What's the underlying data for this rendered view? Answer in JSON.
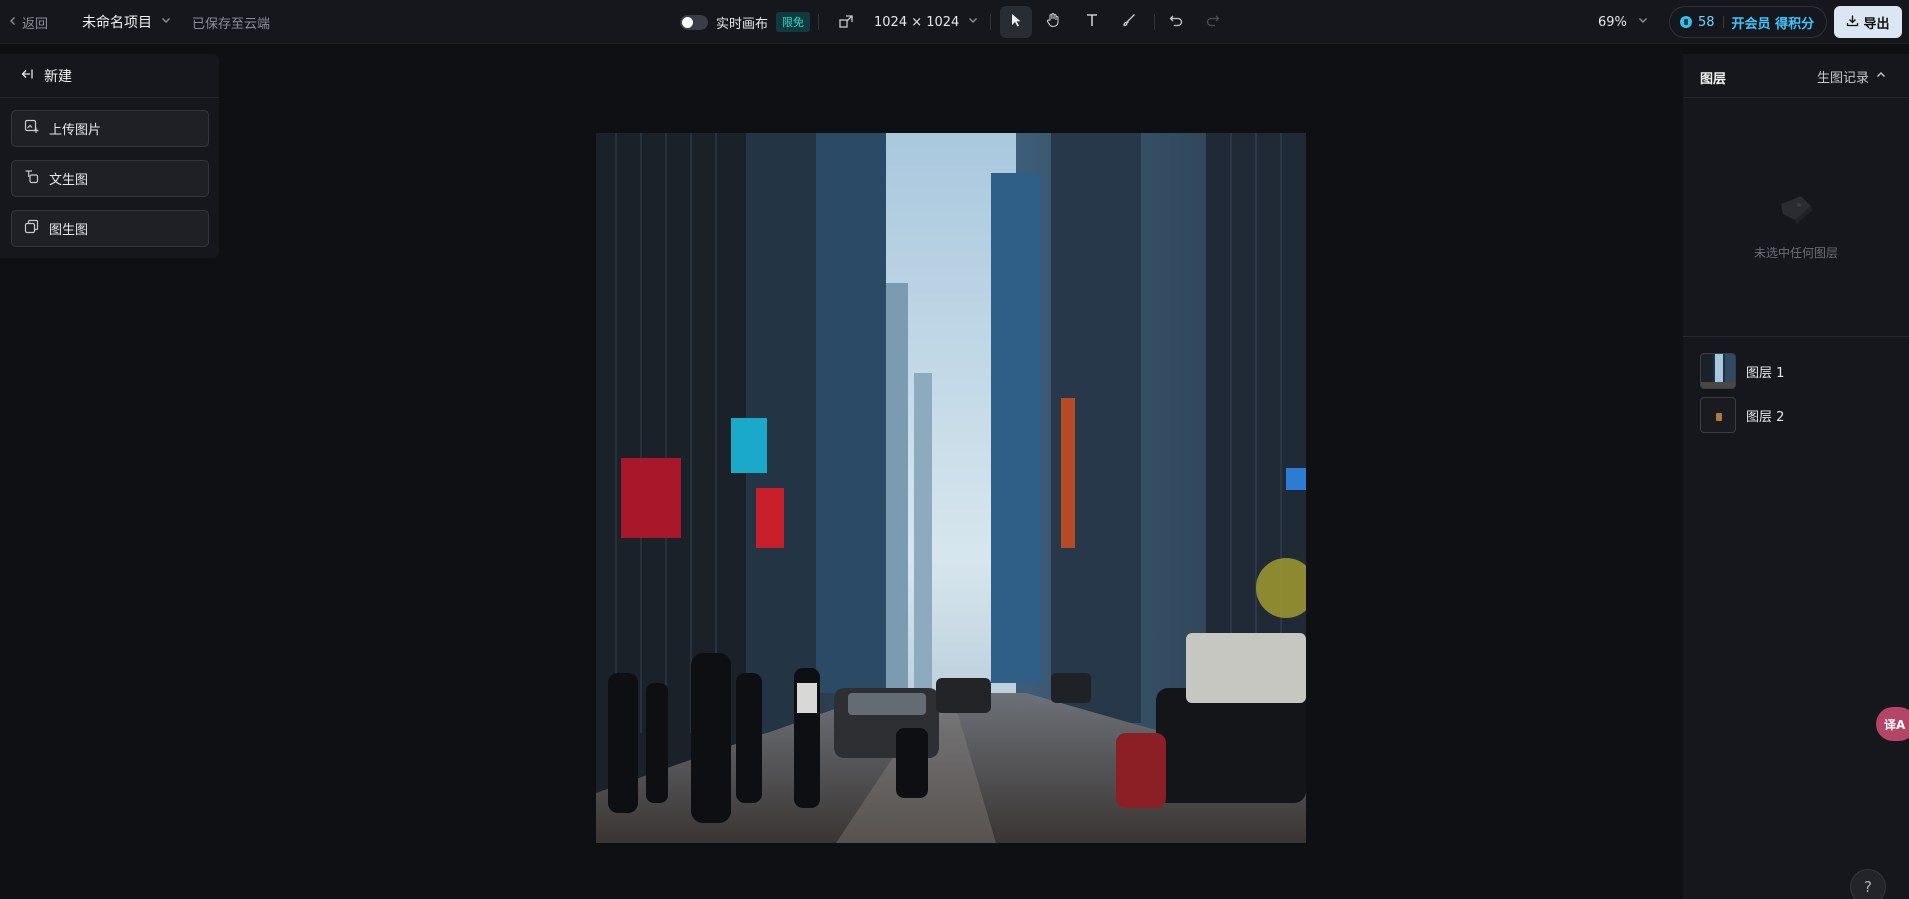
{
  "topbar": {
    "back_label": "返回",
    "project_name": "未命名项目",
    "save_status": "已保存至云端",
    "realtime_label": "实时画布",
    "realtime_badge": "限免",
    "canvas_size": "1024 × 1024",
    "zoom": "69%",
    "credits": "58",
    "vip_label": "开会员 得积分",
    "export_label": "导出"
  },
  "left_panel": {
    "title": "新建",
    "buttons": [
      {
        "label": "上传图片",
        "icon": "upload-image-icon"
      },
      {
        "label": "文生图",
        "icon": "text-to-image-icon"
      },
      {
        "label": "图生图",
        "icon": "image-to-image-icon"
      }
    ]
  },
  "right_panel": {
    "title": "图层",
    "history_label": "生图记录",
    "empty_text": "未选中任何图层",
    "layers": [
      {
        "name": "图层 1"
      },
      {
        "name": "图层 2"
      }
    ]
  },
  "floating": {
    "translate_label": "译A",
    "help_label": "?"
  },
  "colors": {
    "background": "#0f1014",
    "panel": "#16171c",
    "accent_teal": "#33d7c9",
    "accent_blue": "#3fc6ff",
    "export_bg": "#dbe6f3"
  }
}
